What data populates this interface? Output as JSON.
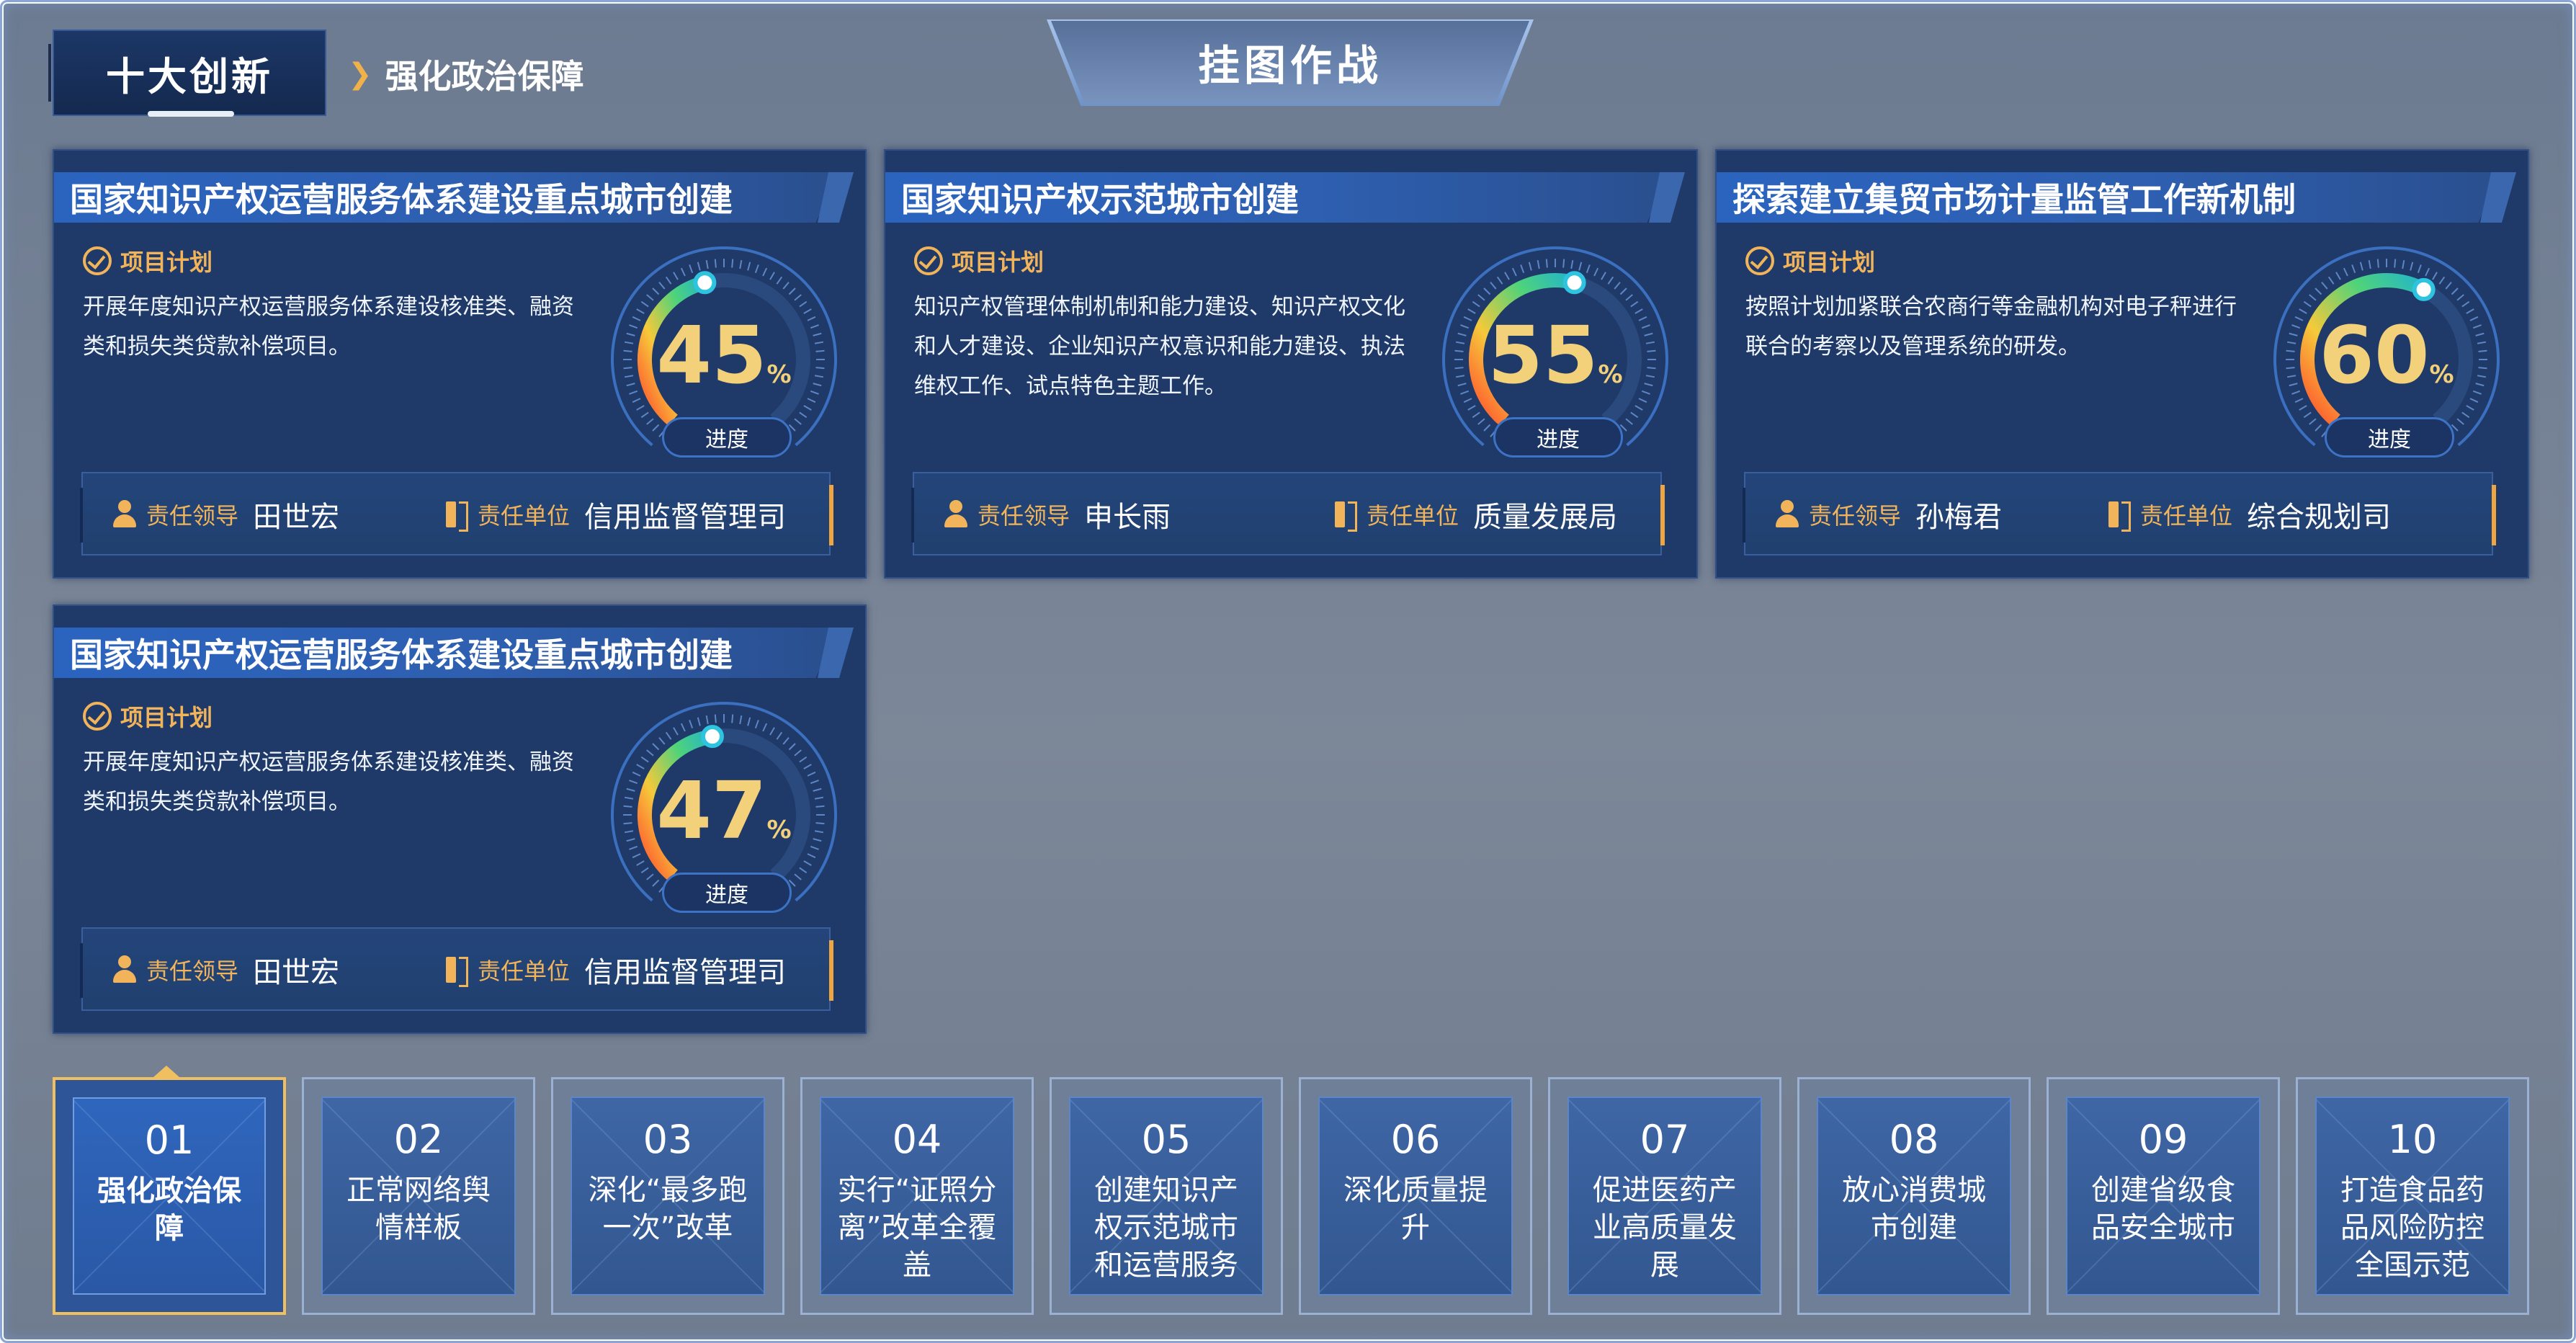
{
  "header": {
    "category_tag": "十大创新",
    "breadcrumb": "强化政治保障",
    "banner_title": "挂图作战"
  },
  "labels": {
    "plan": "项目计划",
    "progress": "进度",
    "leader": "责任领导",
    "unit": "责任单位",
    "percent_symbol": "%"
  },
  "cards": [
    {
      "title": "国家知识产权运营服务体系建设重点城市创建",
      "plan": "开展年度知识产权运营服务体系建设核准类、融资类和损失类贷款补偿项目。",
      "progress": 45,
      "leader": "田世宏",
      "unit": "信用监督管理司"
    },
    {
      "title": "国家知识产权示范城市创建",
      "plan": "知识产权管理体制机制和能力建设、知识产权文化和人才建设、企业知识产权意识和能力建设、执法维权工作、试点特色主题工作。",
      "progress": 55,
      "leader": "申长雨",
      "unit": "质量发展局"
    },
    {
      "title": "探索建立集贸市场计量监管工作新机制",
      "plan": "按照计划加紧联合农商行等金融机构对电子秤进行联合的考察以及管理系统的研发。",
      "progress": 60,
      "leader": "孙梅君",
      "unit": "综合规划司"
    },
    {
      "title": "国家知识产权运营服务体系建设重点城市创建",
      "plan": "开展年度知识产权运营服务体系建设核准类、融资类和损失类贷款补偿项目。",
      "progress": 47,
      "leader": "田世宏",
      "unit": "信用监督管理司"
    }
  ],
  "tabs": [
    {
      "num": "01",
      "label": "强化政治保障",
      "active": true
    },
    {
      "num": "02",
      "label": "正常网络舆情样板",
      "active": false
    },
    {
      "num": "03",
      "label": "深化“最多跑一次”改革",
      "active": false
    },
    {
      "num": "04",
      "label": "实行“证照分离”改革全覆盖",
      "active": false
    },
    {
      "num": "05",
      "label": "创建知识产权示范城市和运营服务",
      "active": false
    },
    {
      "num": "06",
      "label": "深化质量提升",
      "active": false
    },
    {
      "num": "07",
      "label": "促进医药产业高质量发展",
      "active": false
    },
    {
      "num": "08",
      "label": "放心消费城市创建",
      "active": false
    },
    {
      "num": "09",
      "label": "创建省级食品安全城市",
      "active": false
    },
    {
      "num": "10",
      "label": "打造食品药品风险防控全国示范",
      "active": false
    }
  ],
  "colors": {
    "accent_gold": "#f2b45a",
    "gauge_value": "#f3d07a",
    "panel": "#1f3a68"
  }
}
